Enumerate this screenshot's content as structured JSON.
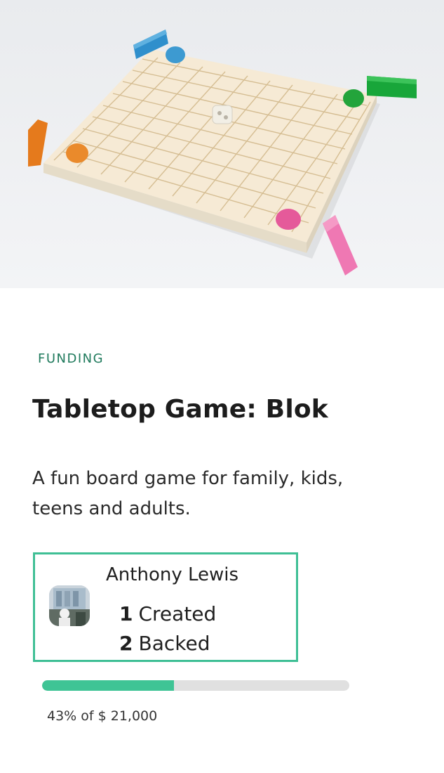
{
  "project": {
    "category": "FUNDING",
    "title": "Tabletop Game: Blok",
    "blurb": "A fun board game for family, kids, teens and adults.",
    "image_alt": "Wooden board game with colored pieces"
  },
  "creator": {
    "name": "Anthony Lewis",
    "created_count": "1",
    "created_label": "Created",
    "backed_count": "2",
    "backed_label": "Backed"
  },
  "funding": {
    "percent_funded": 43,
    "summary": "43% of $ 21,000"
  },
  "colors": {
    "accent": "#3fbf95",
    "category_text": "#1f7a5c",
    "progress_fill": "#3fc495",
    "progress_track": "#e0e0e0"
  }
}
